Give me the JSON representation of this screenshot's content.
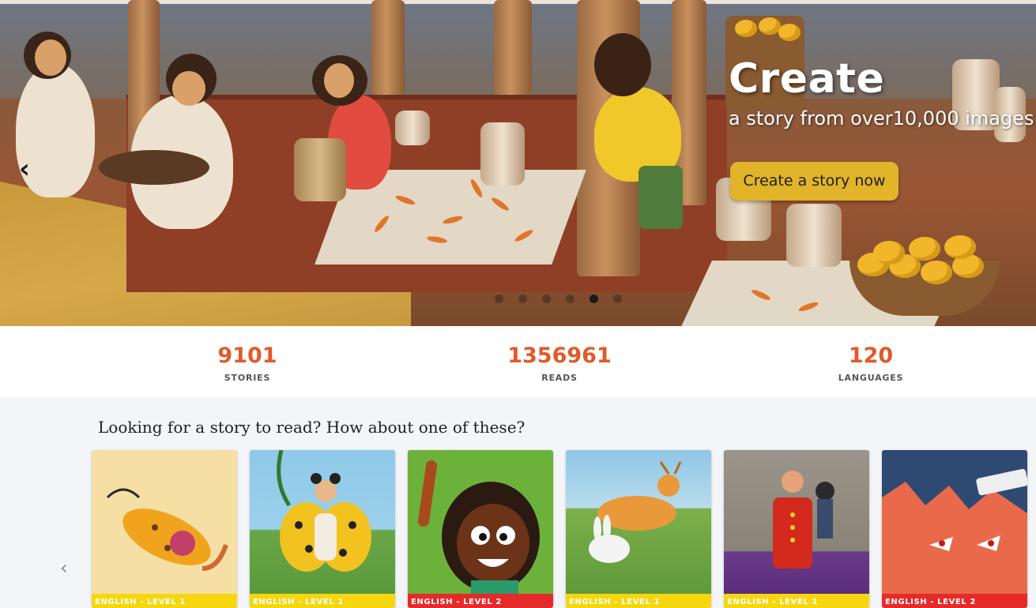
{
  "hero": {
    "title": "Create",
    "subtitle": "a story from over10,000 images!",
    "cta_label": "Create a story now",
    "prev_icon": "chevron-left-icon",
    "prev_glyph": "‹",
    "slides_count": 6,
    "active_slide": 5
  },
  "stats": [
    {
      "value": "9101",
      "label": "STORIES"
    },
    {
      "value": "1356961",
      "label": "READS"
    },
    {
      "value": "120",
      "label": "LANGUAGES"
    }
  ],
  "stories": {
    "heading": "Looking for a story to read? How about one of these?",
    "prev_glyph": "‹",
    "cards": [
      {
        "badge": "ENGLISH - LEVEL 1",
        "level": 1
      },
      {
        "badge": "ENGLISH - LEVEL 1",
        "level": 1
      },
      {
        "badge": "ENGLISH - LEVEL 2",
        "level": 2
      },
      {
        "badge": "ENGLISH - LEVEL 1",
        "level": 1
      },
      {
        "badge": "ENGLISH - LEVEL 1",
        "level": 1
      },
      {
        "badge": "ENGLISH - LEVEL 2",
        "level": 2
      }
    ]
  },
  "colors": {
    "accent_orange": "#e05a2b",
    "button_yellow": "#e1b42a",
    "level1_yellow": "#f6d70f",
    "level2_red": "#e52a2a"
  }
}
